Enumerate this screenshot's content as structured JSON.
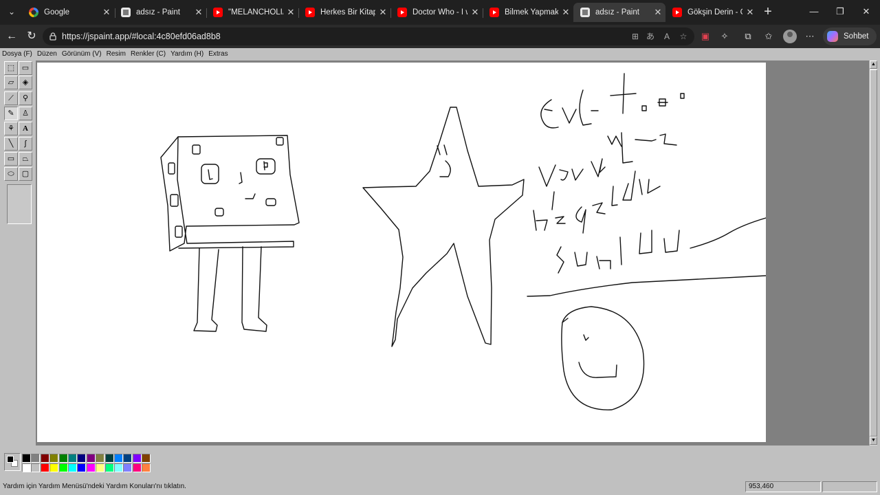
{
  "browser": {
    "tabs": [
      {
        "title": "Google",
        "favicon": "google-icon"
      },
      {
        "title": "adsız - Paint",
        "favicon": "paint-icon"
      },
      {
        "title": "\"MELANCHOLIA\" M",
        "favicon": "youtube-icon"
      },
      {
        "title": "Herkes Bir Kitap - Y",
        "favicon": "youtube-icon"
      },
      {
        "title": "Doctor Who - I will",
        "favicon": "youtube-icon"
      },
      {
        "title": "Bilmek Yapmaktır -",
        "favicon": "youtube-icon"
      },
      {
        "title": "adsız - Paint",
        "favicon": "paint-icon",
        "active": true
      },
      {
        "title": "Gökşin Derin - Gök",
        "favicon": "youtube-icon"
      }
    ],
    "url": "https://jspaint.app/#local:4c80efd06ad8b8",
    "copilot_label": "Sohbet et"
  },
  "menu": [
    "Dosya (F)",
    "Düzen",
    "Görünüm (V)",
    "Resim",
    "Renkler (C)",
    "Yardım (H)",
    "Extras"
  ],
  "tools": [
    "free-form-select",
    "rect-select",
    "eraser",
    "fill-bucket",
    "color-picker",
    "magnifier",
    "pencil",
    "brush",
    "airbrush",
    "text",
    "line",
    "curve",
    "rectangle",
    "polygon",
    "ellipse",
    "rounded-rectangle"
  ],
  "selected_tool": "pencil",
  "palette": {
    "primary": "#000000",
    "secondary": "#ffffff",
    "colors_top": [
      "#000000",
      "#808080",
      "#800000",
      "#808000",
      "#008000",
      "#008080",
      "#000080",
      "#800080",
      "#808040",
      "#004040",
      "#0080ff",
      "#004080",
      "#8000ff",
      "#804000"
    ],
    "colors_bottom": [
      "#ffffff",
      "#c0c0c0",
      "#ff0000",
      "#ffff00",
      "#00ff00",
      "#00ffff",
      "#0000ff",
      "#ff00ff",
      "#ffff80",
      "#00ff80",
      "#80ffff",
      "#8080ff",
      "#ff0080",
      "#ff8040"
    ]
  },
  "status": {
    "help": "Yardım için Yardım Menüsü'ndeki Yardım Konuları'nı tıklatın.",
    "position": "953,460"
  }
}
